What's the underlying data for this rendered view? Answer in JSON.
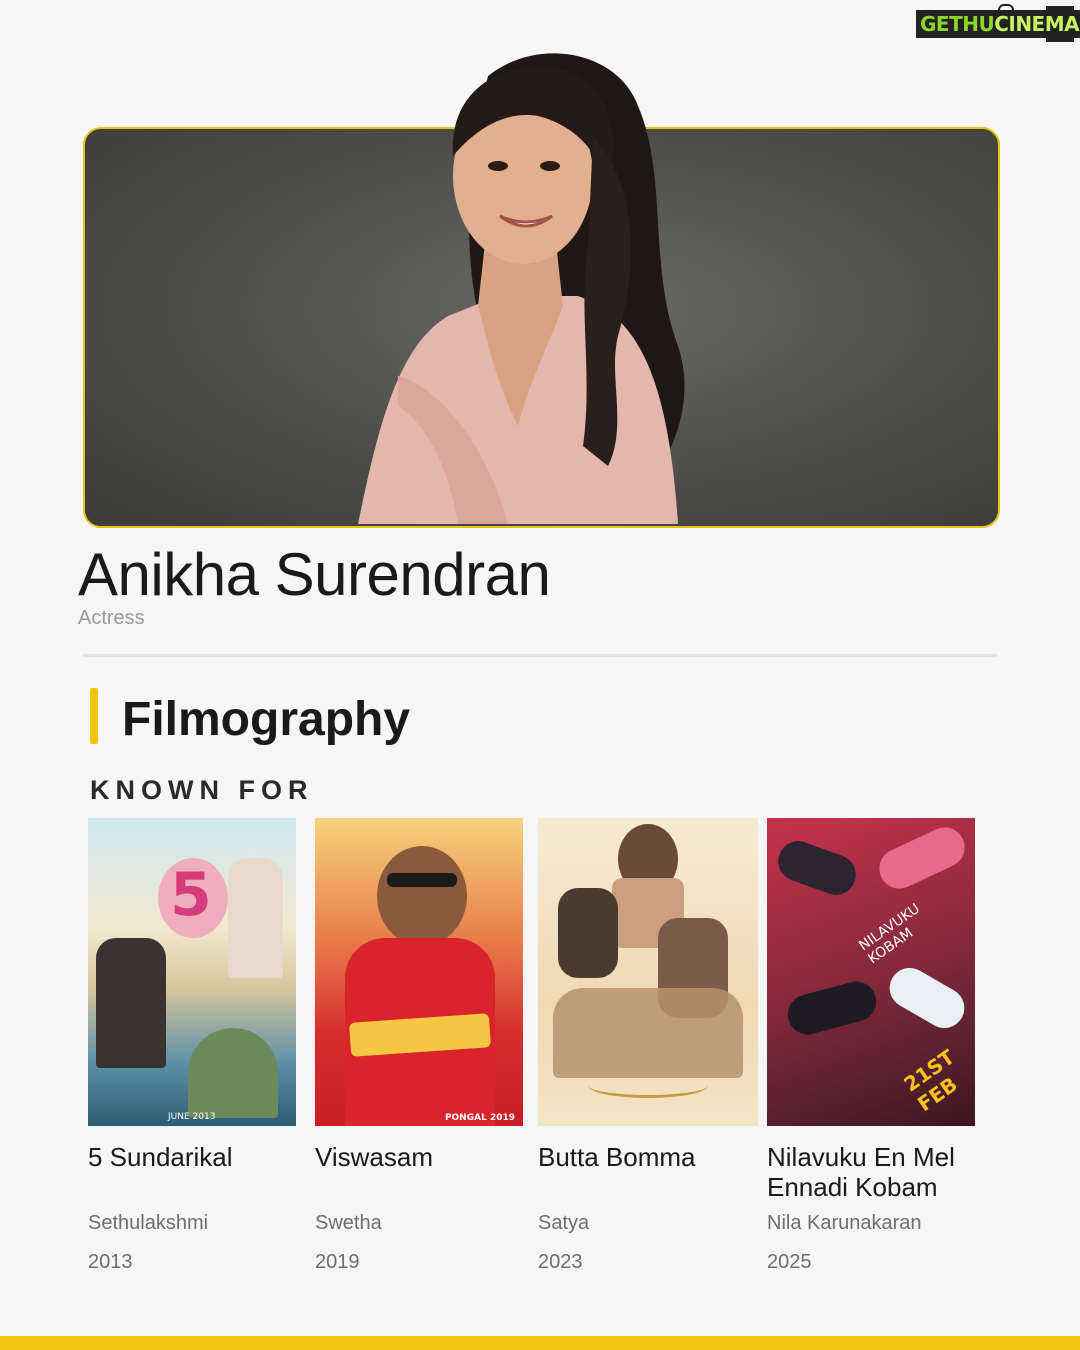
{
  "brand": {
    "logo_part1": "GETHU",
    "logo_part2": "CINEMA"
  },
  "profile": {
    "name": "Anikha Surendran",
    "role": "Actress"
  },
  "section": {
    "title": "Filmography",
    "subtitle": "KNOWN FOR"
  },
  "colors": {
    "accent": "#f1c40f",
    "background": "#f6f6f6"
  },
  "films": [
    {
      "title": "5 Sundarikal",
      "character": "Sethulakshmi",
      "year": "2013",
      "poster_text": "JUNE 2013"
    },
    {
      "title": "Viswasam",
      "character": "Swetha",
      "year": "2019",
      "poster_text": "PONGAL 2019"
    },
    {
      "title": "Butta Bomma",
      "character": "Satya",
      "year": "2023"
    },
    {
      "title": "Nilavuku En Mel Ennadi Kobam",
      "character": "Nila Karunakaran",
      "year": "2025",
      "poster_text": "21ST FEB"
    }
  ]
}
